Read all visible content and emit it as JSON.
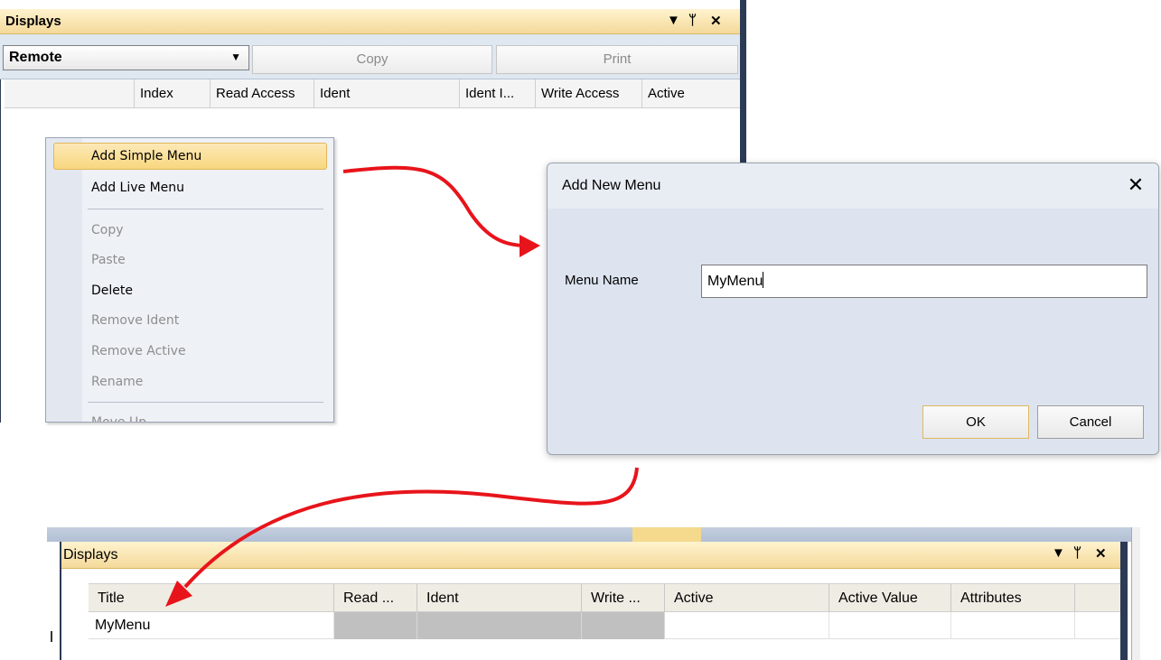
{
  "top_panel": {
    "title": "Displays",
    "remote_combo_value": "Remote",
    "copy_button": "Copy",
    "print_button": "Print",
    "columns": [
      "",
      "Index",
      "Read Access",
      "Ident",
      "Ident I...",
      "Write Access",
      "Active"
    ]
  },
  "context_menu": {
    "items": [
      {
        "label": "Add Simple Menu",
        "enabled": true,
        "highlighted": true
      },
      {
        "label": "Add Live Menu",
        "enabled": true
      },
      {
        "label": "Copy",
        "enabled": false
      },
      {
        "label": "Paste",
        "enabled": false
      },
      {
        "label": "Delete",
        "enabled": true
      },
      {
        "label": "Remove Ident",
        "enabled": false
      },
      {
        "label": "Remove Active",
        "enabled": false
      },
      {
        "label": "Rename",
        "enabled": false
      },
      {
        "label": "Move Up",
        "enabled": false
      }
    ]
  },
  "dialog": {
    "title": "Add New Menu",
    "close_glyph": "✕",
    "field_label": "Menu Name",
    "field_value": "MyMenu",
    "ok_button": "OK",
    "cancel_button": "Cancel"
  },
  "bottom_panel": {
    "title": "Displays",
    "columns": [
      "Title",
      "Read ...",
      "Ident",
      "Write ...",
      "Active",
      "Active Value",
      "Attributes"
    ],
    "rows": [
      {
        "title": "MyMenu"
      }
    ]
  },
  "panel_icons": {
    "dropdown": "▾",
    "pin": "ᵦ",
    "close": "✕"
  },
  "colors": {
    "arrow": "#e8141b",
    "title_bar": "#f4d99a",
    "highlight": "#f8d77f"
  }
}
